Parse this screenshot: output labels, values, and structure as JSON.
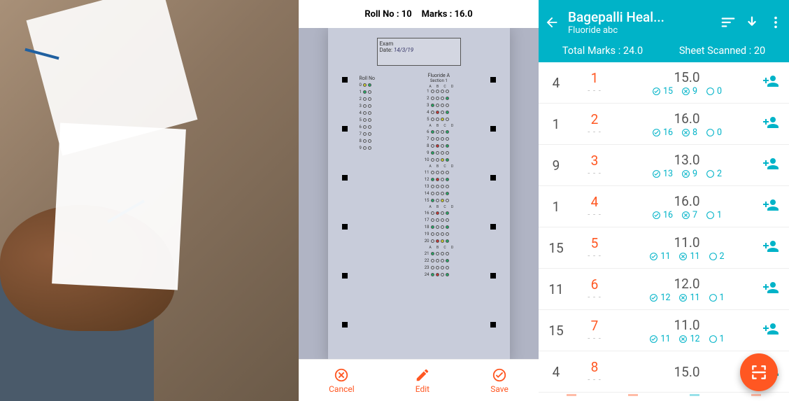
{
  "omr": {
    "header_roll_label": "Roll No :",
    "header_roll_value": "10",
    "header_marks_label": "Marks :",
    "header_marks_value": "16.0",
    "sheet_exam_label": "Exam",
    "sheet_date_label": "Date:",
    "sheet_date_value": "14/3/19",
    "rollno_label": "Roll No",
    "section_label": "Fluoride A",
    "section_sub": "Section 1",
    "options_header": "A  B  C  D",
    "actions": {
      "cancel": "Cancel",
      "edit": "Edit",
      "save": "Save"
    }
  },
  "results": {
    "title": "Bagepalli Heal...",
    "subtitle": "Fluoride abc",
    "total_marks_label": "Total Marks :",
    "total_marks_value": "24.0",
    "sheet_scanned_label": "Sheet Scanned :",
    "sheet_scanned_value": "20",
    "dash": "- - -",
    "rows": [
      {
        "left": "4",
        "idx": "1",
        "marks": "15.0",
        "correct": "15",
        "wrong": "9",
        "blank": "0"
      },
      {
        "left": "1",
        "idx": "2",
        "marks": "16.0",
        "correct": "16",
        "wrong": "8",
        "blank": "0"
      },
      {
        "left": "9",
        "idx": "3",
        "marks": "13.0",
        "correct": "13",
        "wrong": "9",
        "blank": "2"
      },
      {
        "left": "1",
        "idx": "4",
        "marks": "16.0",
        "correct": "16",
        "wrong": "7",
        "blank": "1"
      },
      {
        "left": "15",
        "idx": "5",
        "marks": "11.0",
        "correct": "11",
        "wrong": "11",
        "blank": "2"
      },
      {
        "left": "11",
        "idx": "6",
        "marks": "12.0",
        "correct": "12",
        "wrong": "11",
        "blank": "1"
      },
      {
        "left": "15",
        "idx": "7",
        "marks": "11.0",
        "correct": "11",
        "wrong": "12",
        "blank": "1"
      },
      {
        "left": "4",
        "idx": "8",
        "marks": "15.0",
        "correct": "",
        "wrong": "",
        "blank": ""
      }
    ]
  }
}
